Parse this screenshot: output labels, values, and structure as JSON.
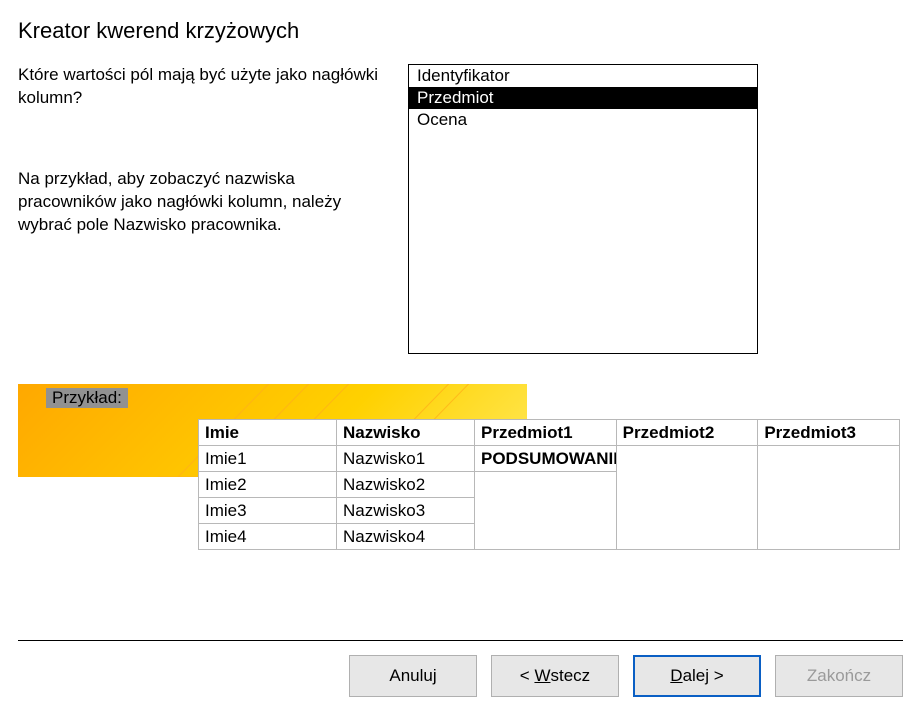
{
  "title": "Kreator kwerend krzyżowych",
  "question": "Które wartości pól mają być użyte jako nagłówki kolumn?",
  "example_text": "Na przykład, aby zobaczyć nazwiska pracowników jako nagłówki kolumn, należy wybrać pole Nazwisko pracownika.",
  "fields": {
    "items": [
      "Identyfikator",
      "Przedmiot",
      "Ocena"
    ],
    "selected_index": 1
  },
  "preview": {
    "label": "Przykład:",
    "headers": [
      "Imie",
      "Nazwisko",
      "Przedmiot1",
      "Przedmiot2",
      "Przedmiot3"
    ],
    "summary": "PODSUMOWANIE",
    "rows": [
      {
        "c0": "Imie1",
        "c1": "Nazwisko1"
      },
      {
        "c0": "Imie2",
        "c1": "Nazwisko2"
      },
      {
        "c0": "Imie3",
        "c1": "Nazwisko3"
      },
      {
        "c0": "Imie4",
        "c1": "Nazwisko4"
      }
    ]
  },
  "buttons": {
    "cancel": "Anuluj",
    "back_prefix": "< ",
    "back_key": "W",
    "back_rest": "stecz",
    "next_key": "D",
    "next_rest": "alej >",
    "finish": "Zakończ"
  }
}
